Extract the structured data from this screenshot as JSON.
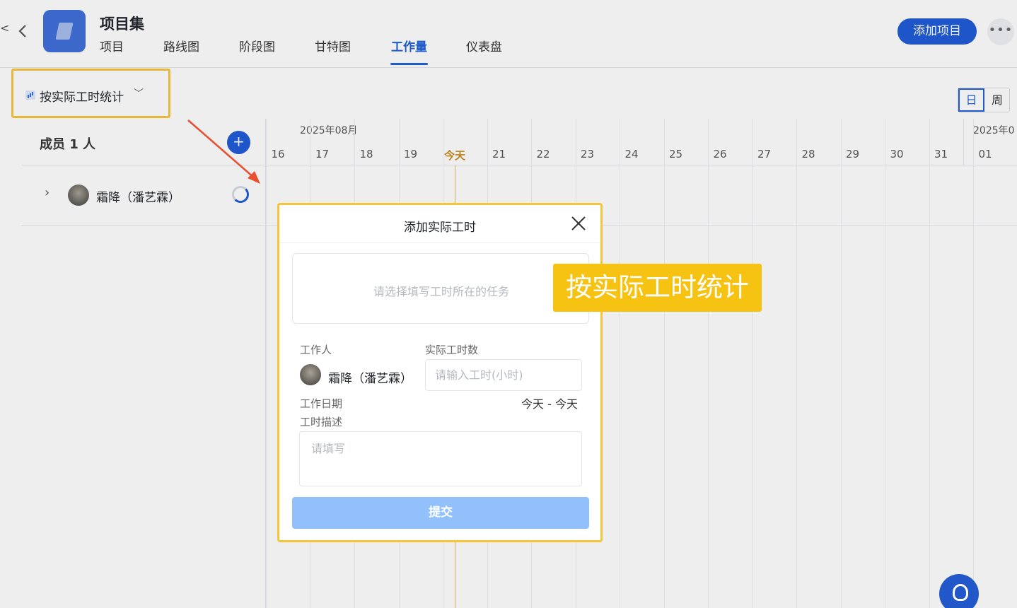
{
  "header": {
    "edge_char": "<",
    "project_title": "项目集",
    "tabs": [
      "项目",
      "路线图",
      "阶段图",
      "甘特图",
      "工作量",
      "仪表盘"
    ],
    "active_tab": "工作量",
    "add_button": "添加项目",
    "more": "•••"
  },
  "toolbar": {
    "stat_select": "按实际工时统计",
    "view_day": "日",
    "view_week": "周"
  },
  "members": {
    "header": "成员 1 人",
    "add": "+",
    "rows": [
      {
        "name": "霜降（潘艺霖）"
      }
    ]
  },
  "timeline": {
    "month": "2025年08月",
    "next_month": "2025年0",
    "days": [
      "16",
      "17",
      "18",
      "19",
      "今天",
      "21",
      "22",
      "23",
      "24",
      "25",
      "26",
      "27",
      "28",
      "29",
      "30",
      "31",
      "01"
    ],
    "today_label": "今天"
  },
  "modal": {
    "title": "添加实际工时",
    "task_placeholder": "请选择填写工时所在的任务",
    "worker_label": "工作人",
    "worker_name": "霜降（潘艺霖）",
    "hours_label": "实际工时数",
    "hours_placeholder": "请输入工时(小时)",
    "date_label": "工作日期",
    "date_range": "今天 - 今天",
    "desc_label": "工时描述",
    "desc_placeholder": "请填写",
    "submit": "提交"
  },
  "callout": "按实际工时统计",
  "colors": {
    "primary": "#1e5ad6",
    "highlight": "#f7c43a",
    "callout_bg": "#f7c313",
    "submit_disabled": "#92c0fb",
    "today": "#c98a18",
    "arrow": "#e8502f"
  }
}
